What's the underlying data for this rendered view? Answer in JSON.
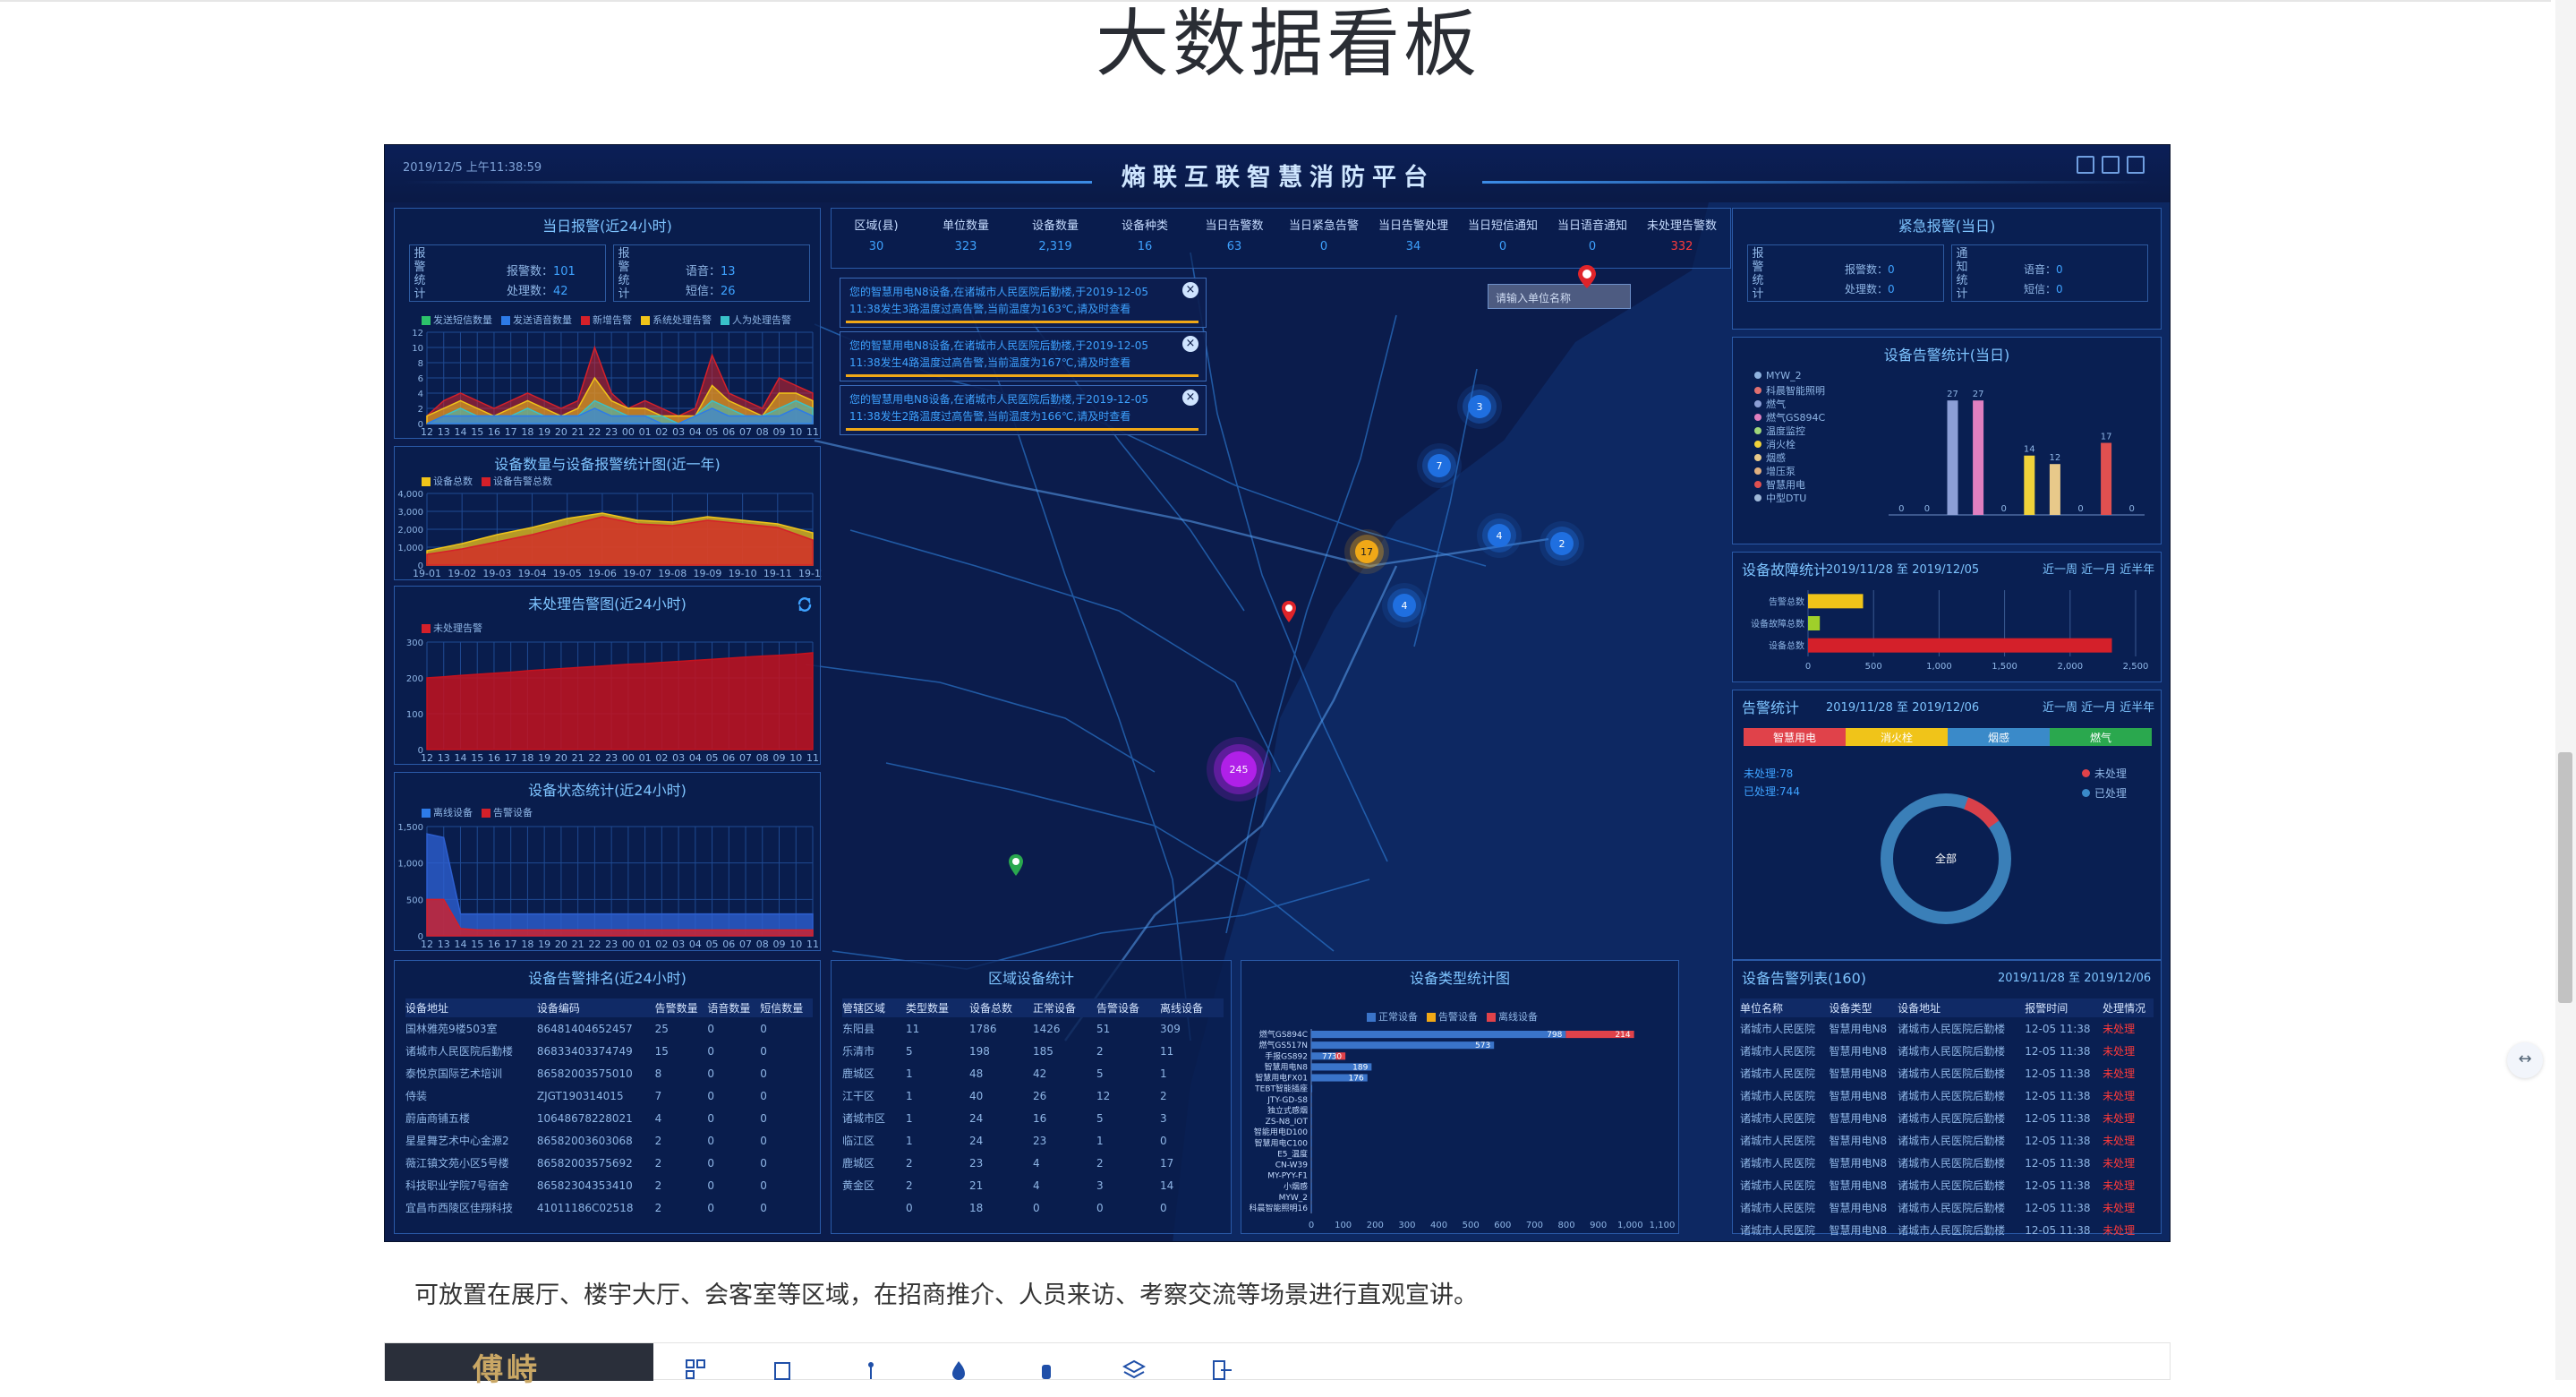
{
  "page": {
    "title": "大数据看板",
    "caption": "可放置在展厅、楼宇大厅、会客室等区域，在招商推介、人员来访、考察交流等场景进行直观宣讲。",
    "bottom_logo": "傅峙"
  },
  "header": {
    "title": "熵联互联智慧消防平台",
    "datetime": "2019/12/5 上午11:38:59"
  },
  "top_stats": [
    {
      "label": "区域(县)",
      "value": "30"
    },
    {
      "label": "单位数量",
      "value": "323"
    },
    {
      "label": "设备数量",
      "value": "2,319"
    },
    {
      "label": "设备种类",
      "value": "16"
    },
    {
      "label": "当日告警数",
      "value": "63"
    },
    {
      "label": "当日紧急告警",
      "value": "0"
    },
    {
      "label": "当日告警处理",
      "value": "34"
    },
    {
      "label": "当日短信通知",
      "value": "0"
    },
    {
      "label": "当日语音通知",
      "value": "0"
    },
    {
      "label": "未处理告警数",
      "value": "332"
    }
  ],
  "alerts": [
    {
      "text": "您的智慧用电N8设备,在诸城市人民医院后勤楼,于2019-12-05 11:38发生3路温度过高告警,当前温度为163℃,请及时查看",
      "close": "×"
    },
    {
      "text": "您的智慧用电N8设备,在诸城市人民医院后勤楼,于2019-12-05 11:38发生4路温度过高告警,当前温度为167℃,请及时查看",
      "close": "×"
    },
    {
      "text": "您的智慧用电N8设备,在诸城市人民医院后勤楼,于2019-12-05 11:38发生2路温度过高告警,当前温度为166℃,请及时查看",
      "close": "×"
    }
  ],
  "map": {
    "search_placeholder": "请输入单位名称",
    "markers": [
      "3",
      "7",
      "17",
      "4",
      "2",
      "4",
      "245"
    ]
  },
  "daily_alarm": {
    "title": "当日报警(近24小时)",
    "group1_label": "报警统计",
    "group2_label": "报警统计",
    "alarm_count_label": "报警数：",
    "alarm_count": "101",
    "handled_label": "处理数：",
    "handled": "42",
    "voice_label": "语音：",
    "voice": "13",
    "sms_label": "短信：",
    "sms": "26",
    "legend": [
      "发送短信数量",
      "发送语音数量",
      "新增告警",
      "系统处理告警",
      "人为处理告警"
    ],
    "legend_colors": [
      "#2cc36b",
      "#2d7be8",
      "#d4202a",
      "#f0c419",
      "#39c2c9"
    ],
    "xticks": [
      "12",
      "13",
      "14",
      "15",
      "16",
      "17",
      "18",
      "19",
      "20",
      "21",
      "22",
      "23",
      "00",
      "01",
      "02",
      "03",
      "04",
      "05",
      "06",
      "07",
      "08",
      "09",
      "10",
      "11"
    ],
    "yticks": [
      "12",
      "10",
      "8",
      "6",
      "4",
      "2",
      "0"
    ]
  },
  "year_chart": {
    "title": "设备数量与设备报警统计图(近一年)",
    "legend": [
      "设备总数",
      "设备告警总数"
    ],
    "legend_colors": [
      "#f0c419",
      "#d4202a"
    ],
    "xticks": [
      "19-01",
      "19-02",
      "19-03",
      "19-04",
      "19-05",
      "19-06",
      "19-07",
      "19-08",
      "19-09",
      "19-10",
      "19-11",
      "19-12"
    ],
    "yticks": [
      "4,000",
      "3,000",
      "2,000",
      "1,000",
      "0"
    ]
  },
  "unhandled": {
    "title": "未处理告警图(近24小时)",
    "legend": [
      "未处理告警"
    ],
    "xticks": [
      "12",
      "13",
      "14",
      "15",
      "16",
      "17",
      "18",
      "19",
      "20",
      "21",
      "22",
      "23",
      "00",
      "01",
      "02",
      "03",
      "04",
      "05",
      "06",
      "07",
      "08",
      "09",
      "10",
      "11"
    ],
    "yticks": [
      "300",
      "200",
      "100",
      "0"
    ]
  },
  "device_status": {
    "title": "设备状态统计(近24小时)",
    "legend": [
      "离线设备",
      "告警设备"
    ],
    "xticks": [
      "12",
      "13",
      "14",
      "15",
      "16",
      "17",
      "18",
      "19",
      "20",
      "21",
      "22",
      "23",
      "00",
      "01",
      "02",
      "03",
      "04",
      "05",
      "06",
      "07",
      "08",
      "09",
      "10",
      "11"
    ],
    "yticks": [
      "1,500",
      "1,000",
      "500",
      "0"
    ]
  },
  "ranking": {
    "title": "设备告警排名(近24小时)",
    "headers": [
      "设备地址",
      "设备编码",
      "告警数量",
      "语音数量",
      "短信数量"
    ],
    "rows": [
      [
        "国林雅苑9楼503室",
        "86481404652457",
        "25",
        "0",
        "0"
      ],
      [
        "诸城市人民医院后勤楼",
        "86833403374749",
        "15",
        "0",
        "0"
      ],
      [
        "泰悦京国际艺术培训",
        "86582003575010",
        "8",
        "0",
        "0"
      ],
      [
        "侍装",
        "ZJGT190314015",
        "7",
        "0",
        "0"
      ],
      [
        "蔚庙商铺五楼",
        "10648678228021",
        "4",
        "0",
        "0"
      ],
      [
        "星星舞艺术中心金源2",
        "86582003603068",
        "2",
        "0",
        "0"
      ],
      [
        "薇江镇文苑小区5号楼",
        "86582003575692",
        "2",
        "0",
        "0"
      ],
      [
        "科技职业学院7号宿舍",
        "86582304353410",
        "2",
        "0",
        "0"
      ],
      [
        "宜昌市西陵区佳翔科技",
        "41011186C02518",
        "2",
        "0",
        "0"
      ]
    ]
  },
  "region": {
    "title": "区域设备统计",
    "headers": [
      "管辖区域",
      "类型数量",
      "设备总数",
      "正常设备",
      "告警设备",
      "离线设备"
    ],
    "rows": [
      [
        "东阳县",
        "11",
        "1786",
        "1426",
        "51",
        "309"
      ],
      [
        "乐清市",
        "5",
        "198",
        "185",
        "2",
        "11"
      ],
      [
        "鹿城区",
        "1",
        "48",
        "42",
        "5",
        "1"
      ],
      [
        "江干区",
        "1",
        "40",
        "26",
        "12",
        "2"
      ],
      [
        "诸城市区",
        "1",
        "24",
        "16",
        "5",
        "3"
      ],
      [
        "临江区",
        "1",
        "24",
        "23",
        "1",
        "0"
      ],
      [
        "鹿城区",
        "2",
        "23",
        "4",
        "2",
        "17"
      ],
      [
        "黄金区",
        "2",
        "21",
        "4",
        "3",
        "14"
      ],
      [
        "",
        "0",
        "18",
        "0",
        "0",
        "0"
      ]
    ]
  },
  "type_chart": {
    "title": "设备类型统计图",
    "legend": [
      "正常设备",
      "告警设备",
      "离线设备"
    ],
    "legend_colors": [
      "#3a74c9",
      "#f0a817",
      "#e0424a"
    ],
    "xticks": [
      "0",
      "100",
      "200",
      "300",
      "400",
      "500",
      "600",
      "700",
      "800",
      "900",
      "1,000",
      "1,100"
    ]
  },
  "chart_data": [
    {
      "type": "area",
      "title": "当日报警(近24小时)",
      "x": [
        "12",
        "13",
        "14",
        "15",
        "16",
        "17",
        "18",
        "19",
        "20",
        "21",
        "22",
        "23",
        "00",
        "01",
        "02",
        "03",
        "04",
        "05",
        "06",
        "07",
        "08",
        "09",
        "10",
        "11"
      ],
      "ylim": [
        0,
        12
      ],
      "series": [
        {
          "name": "新增告警",
          "values": [
            1,
            3,
            4,
            3,
            2,
            3,
            4,
            3,
            2,
            3,
            10,
            4,
            2,
            3,
            2,
            1,
            2,
            9,
            4,
            3,
            2,
            6,
            5,
            4
          ]
        },
        {
          "name": "系统处理告警",
          "values": [
            1,
            2,
            3,
            2,
            1,
            2,
            3,
            2,
            1,
            2,
            6,
            3,
            2,
            2,
            1,
            1,
            1,
            5,
            3,
            2,
            1,
            4,
            4,
            3
          ]
        },
        {
          "name": "人为处理告警",
          "values": [
            0,
            1,
            2,
            1,
            1,
            1,
            2,
            1,
            1,
            1,
            3,
            2,
            1,
            1,
            1,
            0,
            1,
            3,
            2,
            1,
            1,
            2,
            3,
            2
          ]
        },
        {
          "name": "发送语音数量",
          "values": [
            0,
            1,
            1,
            1,
            1,
            1,
            1,
            1,
            1,
            1,
            2,
            1,
            1,
            1,
            0,
            0,
            1,
            2,
            1,
            1,
            1,
            1,
            2,
            1
          ]
        }
      ]
    },
    {
      "type": "area",
      "title": "设备数量与设备报警统计图(近一年)",
      "x": [
        "19-01",
        "19-02",
        "19-03",
        "19-04",
        "19-05",
        "19-06",
        "19-07",
        "19-08",
        "19-09",
        "19-10",
        "19-11",
        "19-12"
      ],
      "ylim": [
        0,
        4000
      ],
      "series": [
        {
          "name": "设备总数",
          "values": [
            800,
            1200,
            1700,
            2100,
            2600,
            2900,
            2500,
            2400,
            2700,
            2500,
            2300,
            1800
          ]
        },
        {
          "name": "设备告警总数",
          "values": [
            600,
            900,
            1300,
            1700,
            2200,
            2700,
            2300,
            2200,
            2500,
            2300,
            2100,
            1400
          ]
        }
      ]
    },
    {
      "type": "area",
      "title": "未处理告警图(近24小时)",
      "x": [
        "12",
        "13",
        "14",
        "15",
        "16",
        "17",
        "18",
        "19",
        "20",
        "21",
        "22",
        "23",
        "00",
        "01",
        "02",
        "03",
        "04",
        "05",
        "06",
        "07",
        "08",
        "09",
        "10",
        "11"
      ],
      "ylim": [
        0,
        300
      ],
      "series": [
        {
          "name": "未处理告警",
          "values": [
            200,
            203,
            207,
            210,
            213,
            216,
            220,
            223,
            226,
            229,
            232,
            235,
            238,
            240,
            243,
            246,
            249,
            252,
            255,
            258,
            261,
            263,
            266,
            270
          ]
        }
      ]
    },
    {
      "type": "area",
      "title": "设备状态统计(近24小时)",
      "x": [
        "12",
        "13",
        "14",
        "15",
        "16",
        "17",
        "18",
        "19",
        "20",
        "21",
        "22",
        "23",
        "00",
        "01",
        "02",
        "03",
        "04",
        "05",
        "06",
        "07",
        "08",
        "09",
        "10",
        "11"
      ],
      "ylim": [
        0,
        1500
      ],
      "series": [
        {
          "name": "离线设备",
          "values": [
            1400,
            1350,
            300,
            300,
            300,
            300,
            300,
            300,
            300,
            300,
            300,
            300,
            300,
            300,
            300,
            300,
            300,
            300,
            300,
            300,
            300,
            300,
            300,
            300
          ]
        },
        {
          "name": "告警设备",
          "values": [
            500,
            500,
            100,
            80,
            80,
            80,
            80,
            80,
            80,
            80,
            80,
            80,
            80,
            80,
            80,
            80,
            80,
            80,
            80,
            80,
            80,
            80,
            80,
            80
          ]
        }
      ]
    },
    {
      "type": "bar",
      "title": "设备类型统计图",
      "orientation": "horizontal",
      "categories": [
        "燃气GS894C",
        "燃气GS517N",
        "手报GS892",
        "智慧用电N8",
        "智慧用电FX01",
        "TEBT智能插座",
        "JTY-GD-S8",
        "独立式感烟",
        "ZS-N8_IOT",
        "智能用电D100",
        "智慧用电C100",
        "E5_温度",
        "CN-W39",
        "MY-PYY-F1",
        "小烟感",
        "MYW_2",
        "科晨智能照明16"
      ],
      "x_range": [
        0,
        1100
      ],
      "series": [
        {
          "name": "正常设备",
          "values": [
            798,
            573,
            77,
            189,
            176,
            3,
            2,
            2,
            2,
            2,
            2,
            2,
            2,
            2,
            2,
            2,
            2
          ]
        },
        {
          "name": "告警设备",
          "values": [
            0,
            0,
            0,
            0,
            0,
            0,
            0,
            0,
            0,
            0,
            0,
            0,
            0,
            0,
            0,
            0,
            0
          ]
        },
        {
          "name": "离线设备",
          "values": [
            214,
            0,
            30,
            0,
            0,
            0,
            0,
            0,
            0,
            0,
            0,
            0,
            0,
            0,
            0,
            0,
            0
          ]
        }
      ]
    },
    {
      "type": "bar",
      "title": "设备告警统计(当日)",
      "categories": [
        "MYW_2",
        "科晨智能照明",
        "燃气",
        "燃气GS894C",
        "温度监控",
        "消火栓",
        "烟感",
        "增压泵",
        "智慧用电",
        "中型DTU"
      ],
      "values": [
        0,
        0,
        27,
        27,
        0,
        14,
        12,
        0,
        17,
        0
      ]
    },
    {
      "type": "bar",
      "title": "设备故障统计",
      "orientation": "horizontal",
      "categories": [
        "告警总数",
        "设备故障总数",
        "设备总数"
      ],
      "values": [
        420,
        90,
        2319
      ],
      "xlim": [
        0,
        2500
      ]
    },
    {
      "type": "pie",
      "title": "告警统计",
      "categories": [
        "未处理",
        "已处理"
      ],
      "values": [
        78,
        744
      ]
    }
  ],
  "emergency": {
    "title": "紧急报警(当日)",
    "group1_label": "报警统计",
    "group2_label": "通知统计",
    "alarm_label": "报警数：",
    "alarm": "0",
    "handled_label": "处理数：",
    "handled": "0",
    "voice_label": "语音：",
    "voice": "0",
    "sms_label": "短信：",
    "sms": "0"
  },
  "daily_dev_alarm": {
    "title": "设备告警统计(当日)",
    "legend": [
      "MYW_2",
      "科晨智能照明",
      "燃气",
      "燃气GS894C",
      "温度监控",
      "消火栓",
      "烟感",
      "增压泵",
      "智慧用电",
      "中型DTU"
    ],
    "colors": [
      "#8fb3e0",
      "#e07070",
      "#8c9fd6",
      "#e07fc0",
      "#9fd67a",
      "#f0d23a",
      "#e8c98a",
      "#e0b080",
      "#e05050",
      "#9fb8d8"
    ]
  },
  "fault": {
    "title": "设备故障统计",
    "date": "2019/11/28 至 2019/12/05",
    "range": "近一周 近一月 近半年",
    "labels": [
      "告警总数",
      "设备故障总数",
      "设备总数"
    ],
    "xticks": [
      "0",
      "500",
      "1,000",
      "1,500",
      "2,000",
      "2,500"
    ]
  },
  "alarm_stats": {
    "title": "告警统计",
    "date": "2019/11/28 至 2019/12/06",
    "range": "近一周 近一月 近半年",
    "tabs": [
      "智慧用电",
      "消火栓",
      "烟感",
      "燃气"
    ],
    "tab_colors": [
      "#e0424a",
      "#f0c419",
      "#3a8ac9",
      "#2aa84e"
    ],
    "unhandled_text": "未处理:78",
    "handled_text": "已处理:744",
    "center": "全部",
    "legend": [
      "未处理",
      "已处理"
    ]
  },
  "alarm_list": {
    "title": "设备告警列表(160)",
    "date": "2019/11/28 至 2019/12/06",
    "headers": [
      "单位名称",
      "设备类型",
      "设备地址",
      "报警时间",
      "处理情况"
    ],
    "rows": [
      [
        "诸城市人民医院",
        "智慧用电N8",
        "诸城市人民医院后勤楼",
        "12-05 11:38",
        "未处理"
      ],
      [
        "诸城市人民医院",
        "智慧用电N8",
        "诸城市人民医院后勤楼",
        "12-05 11:38",
        "未处理"
      ],
      [
        "诸城市人民医院",
        "智慧用电N8",
        "诸城市人民医院后勤楼",
        "12-05 11:38",
        "未处理"
      ],
      [
        "诸城市人民医院",
        "智慧用电N8",
        "诸城市人民医院后勤楼",
        "12-05 11:38",
        "未处理"
      ],
      [
        "诸城市人民医院",
        "智慧用电N8",
        "诸城市人民医院后勤楼",
        "12-05 11:38",
        "未处理"
      ],
      [
        "诸城市人民医院",
        "智慧用电N8",
        "诸城市人民医院后勤楼",
        "12-05 11:38",
        "未处理"
      ],
      [
        "诸城市人民医院",
        "智慧用电N8",
        "诸城市人民医院后勤楼",
        "12-05 11:38",
        "未处理"
      ],
      [
        "诸城市人民医院",
        "智慧用电N8",
        "诸城市人民医院后勤楼",
        "12-05 11:38",
        "未处理"
      ],
      [
        "诸城市人民医院",
        "智慧用电N8",
        "诸城市人民医院后勤楼",
        "12-05 11:38",
        "未处理"
      ],
      [
        "诸城市人民医院",
        "智慧用电N8",
        "诸城市人民医院后勤楼",
        "12-05 11:38",
        "未处理"
      ]
    ]
  }
}
